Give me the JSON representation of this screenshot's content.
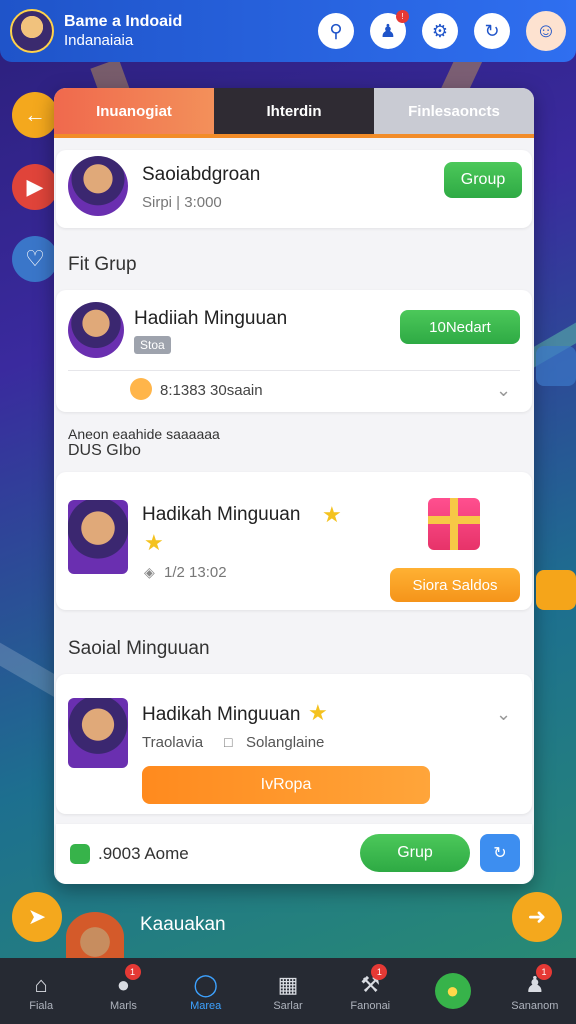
{
  "header": {
    "title": "Bame a Indoaid",
    "subtitle": "Indanaiaia",
    "icons": [
      "search-icon",
      "user-alert-icon",
      "gear-icon",
      "refresh-icon",
      "face-icon"
    ]
  },
  "tabs": [
    "Inuanogiat",
    "Ihterdin",
    "Finlesaoncts"
  ],
  "profile_card": {
    "name": "Saoiabdgroan",
    "meta": "Sirpi | 3:000",
    "button": "Group"
  },
  "sections": {
    "fit_group": "Fit Grup",
    "announce_line1": "Aneon eaahide saaaaaa",
    "announce_line2": "DUS GIbo",
    "weekly": "Saoial Minguuan"
  },
  "card2": {
    "name": "Hadiiah Minguuan",
    "badge": "Stoa",
    "button": "10Nedart",
    "reward": "8:1383 30saain"
  },
  "card3": {
    "name": "Hadikah Minguuan",
    "time": "1/2 13:02",
    "button": "Siora Saldos"
  },
  "card4": {
    "name": "Hadikah Minguuan",
    "line": "Traolavia",
    "line2": "Solanglaine",
    "button": "IvRopa"
  },
  "footer_bar": {
    "label": ".9003 Aome",
    "button": "Grup"
  },
  "behind_card": {
    "name": "Kaauakan"
  },
  "bottom_nav": [
    {
      "label": "Fiala",
      "icon": "home-icon",
      "badge": ""
    },
    {
      "label": "Marls",
      "icon": "chat-icon",
      "badge": "1"
    },
    {
      "label": "Marea",
      "icon": "compass-icon",
      "badge": ""
    },
    {
      "label": "Sarlar",
      "icon": "book-icon",
      "badge": ""
    },
    {
      "label": "Fanonai",
      "icon": "tools-icon",
      "badge": "1"
    },
    {
      "label": "",
      "icon": "bubble-icon",
      "badge": ""
    },
    {
      "label": "Sananom",
      "icon": "profile-icon",
      "badge": "1"
    }
  ],
  "colors": {
    "primary": "#2f6ff0",
    "accent_orange": "#f5941a",
    "accent_green": "#2eaa44"
  }
}
